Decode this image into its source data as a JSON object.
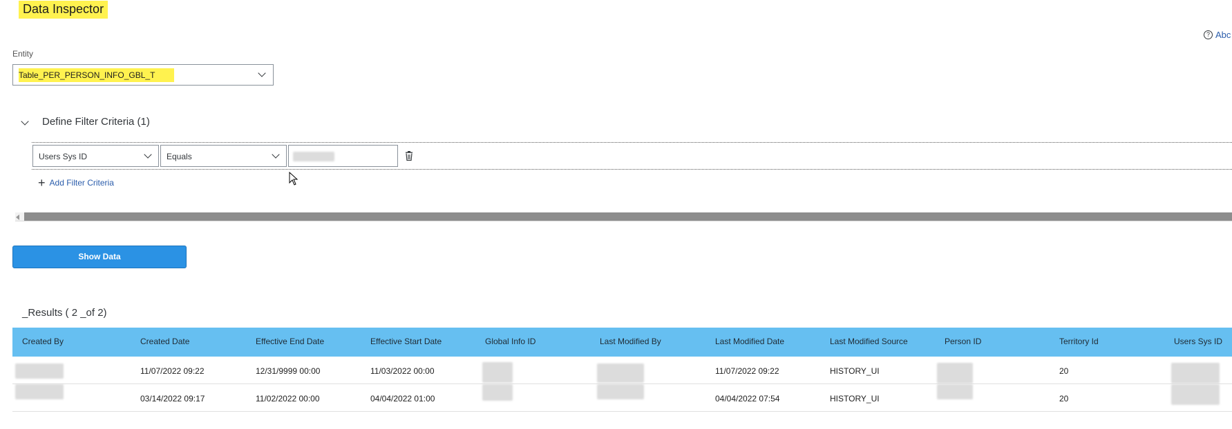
{
  "page": {
    "title": "Data Inspector",
    "about_label": "Abc"
  },
  "entity": {
    "label": "Entity",
    "value": "Table_PER_PERSON_INFO_GBL_T"
  },
  "filter": {
    "header": "Define Filter Criteria (1)",
    "field": "Users Sys ID",
    "operator": "Equals",
    "add_label": "Add Filter Criteria"
  },
  "actions": {
    "show_data": "Show Data"
  },
  "results": {
    "title": "_Results ( 2 _of 2)",
    "columns": [
      "Created By",
      "Created Date",
      "Effective End Date",
      "Effective Start Date",
      "Global Info ID",
      "Last Modified By",
      "Last Modified Date",
      "Last Modified Source",
      "Person ID",
      "Territory Id",
      "Users Sys ID"
    ],
    "rows": [
      {
        "created_date": "11/07/2022 09:22",
        "effective_end_date": "12/31/9999 00:00",
        "effective_start_date": "11/03/2022 00:00",
        "last_modified_date": "11/07/2022 09:22",
        "last_modified_source": "HISTORY_UI",
        "territory_id": "20"
      },
      {
        "created_date": "03/14/2022 09:17",
        "effective_end_date": "11/02/2022 00:00",
        "effective_start_date": "04/04/2022 01:00",
        "last_modified_date": "04/04/2022 07:54",
        "last_modified_source": "HISTORY_UI",
        "territory_id": "20"
      }
    ]
  },
  "colors": {
    "highlight": "#fff24f",
    "accent": "#2b92e4",
    "table_header": "#66bff1",
    "link": "#2a5cab"
  }
}
